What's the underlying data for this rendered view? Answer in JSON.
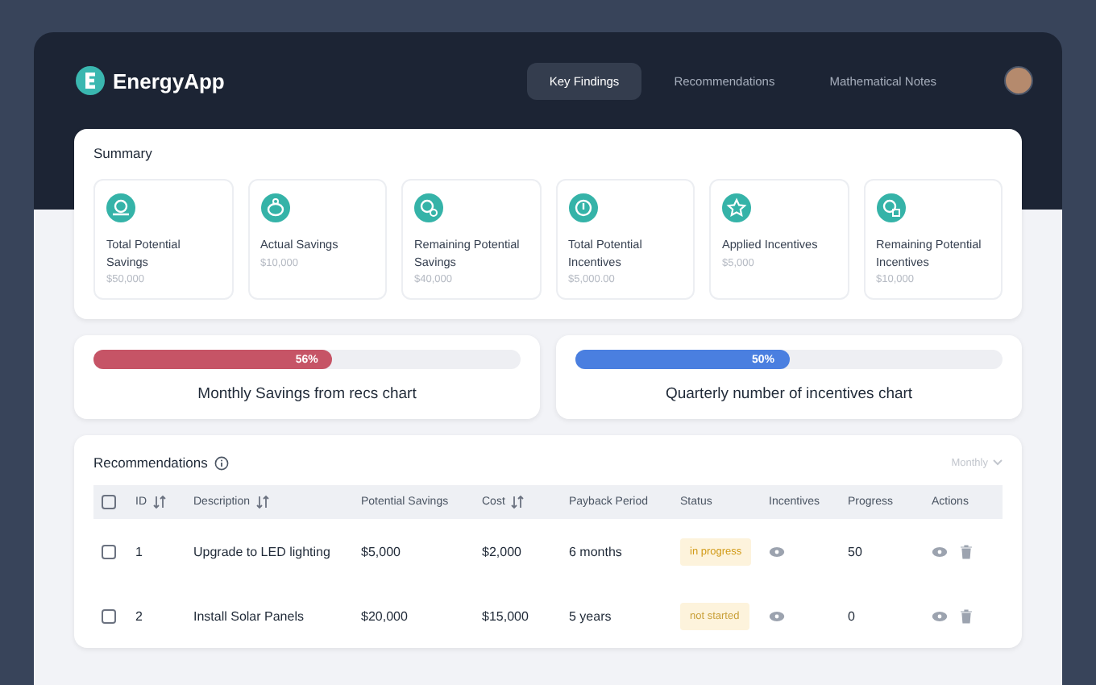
{
  "app": {
    "name": "EnergyApp"
  },
  "nav": [
    {
      "label": "Key Findings",
      "selected": true
    },
    {
      "label": "Recommendations",
      "selected": false
    },
    {
      "label": "Mathematical Notes",
      "selected": false
    }
  ],
  "summary": {
    "title": "Summary",
    "cards": [
      {
        "label": "Total Potential Savings",
        "value": "$50,000"
      },
      {
        "label": "Actual Savings",
        "value": "$10,000"
      },
      {
        "label": "Remaining Potential Savings",
        "value": "$40,000"
      },
      {
        "label": "Total Potential Incentives",
        "value": "$5,000.00"
      },
      {
        "label": "Applied Incentives",
        "value": "$5,000"
      },
      {
        "label": "Remaining Potential Incentives",
        "value": "$10,000"
      }
    ]
  },
  "progress_cards": [
    {
      "label": "Monthly Savings from recs chart",
      "level": 0.56,
      "reading": "56%",
      "color": "#c65466"
    },
    {
      "label": "Quarterly number of incentives chart",
      "level": 0.5,
      "reading": "50%",
      "color": "#4a7fe0"
    }
  ],
  "recommendations": {
    "title": "Recommendations",
    "period": "Monthly",
    "all_checked": false,
    "columns": [
      {
        "label": "ID",
        "sortable": true
      },
      {
        "label": "Description",
        "sortable": true
      },
      {
        "label": "Potential Savings",
        "sortable": false
      },
      {
        "label": "Cost",
        "sortable": true
      },
      {
        "label": "Payback Period",
        "sortable": false
      },
      {
        "label": "Status",
        "sortable": false
      },
      {
        "label": "Incentives",
        "sortable": false
      },
      {
        "label": "Progress",
        "sortable": false
      },
      {
        "label": "Actions",
        "sortable": false
      }
    ],
    "rows": [
      {
        "checked": false,
        "id": "1",
        "description": "Upgrade to LED lighting",
        "savings": "$5,000",
        "cost": "$2,000",
        "payback": "6 months",
        "status": {
          "label": "in progress",
          "kind": "progress"
        },
        "progress": "50"
      },
      {
        "checked": false,
        "id": "2",
        "description": "Install Solar Panels",
        "savings": "$20,000",
        "cost": "$15,000",
        "payback": "5 years",
        "status": {
          "label": "not started",
          "kind": "pending"
        },
        "progress": "0"
      }
    ]
  }
}
